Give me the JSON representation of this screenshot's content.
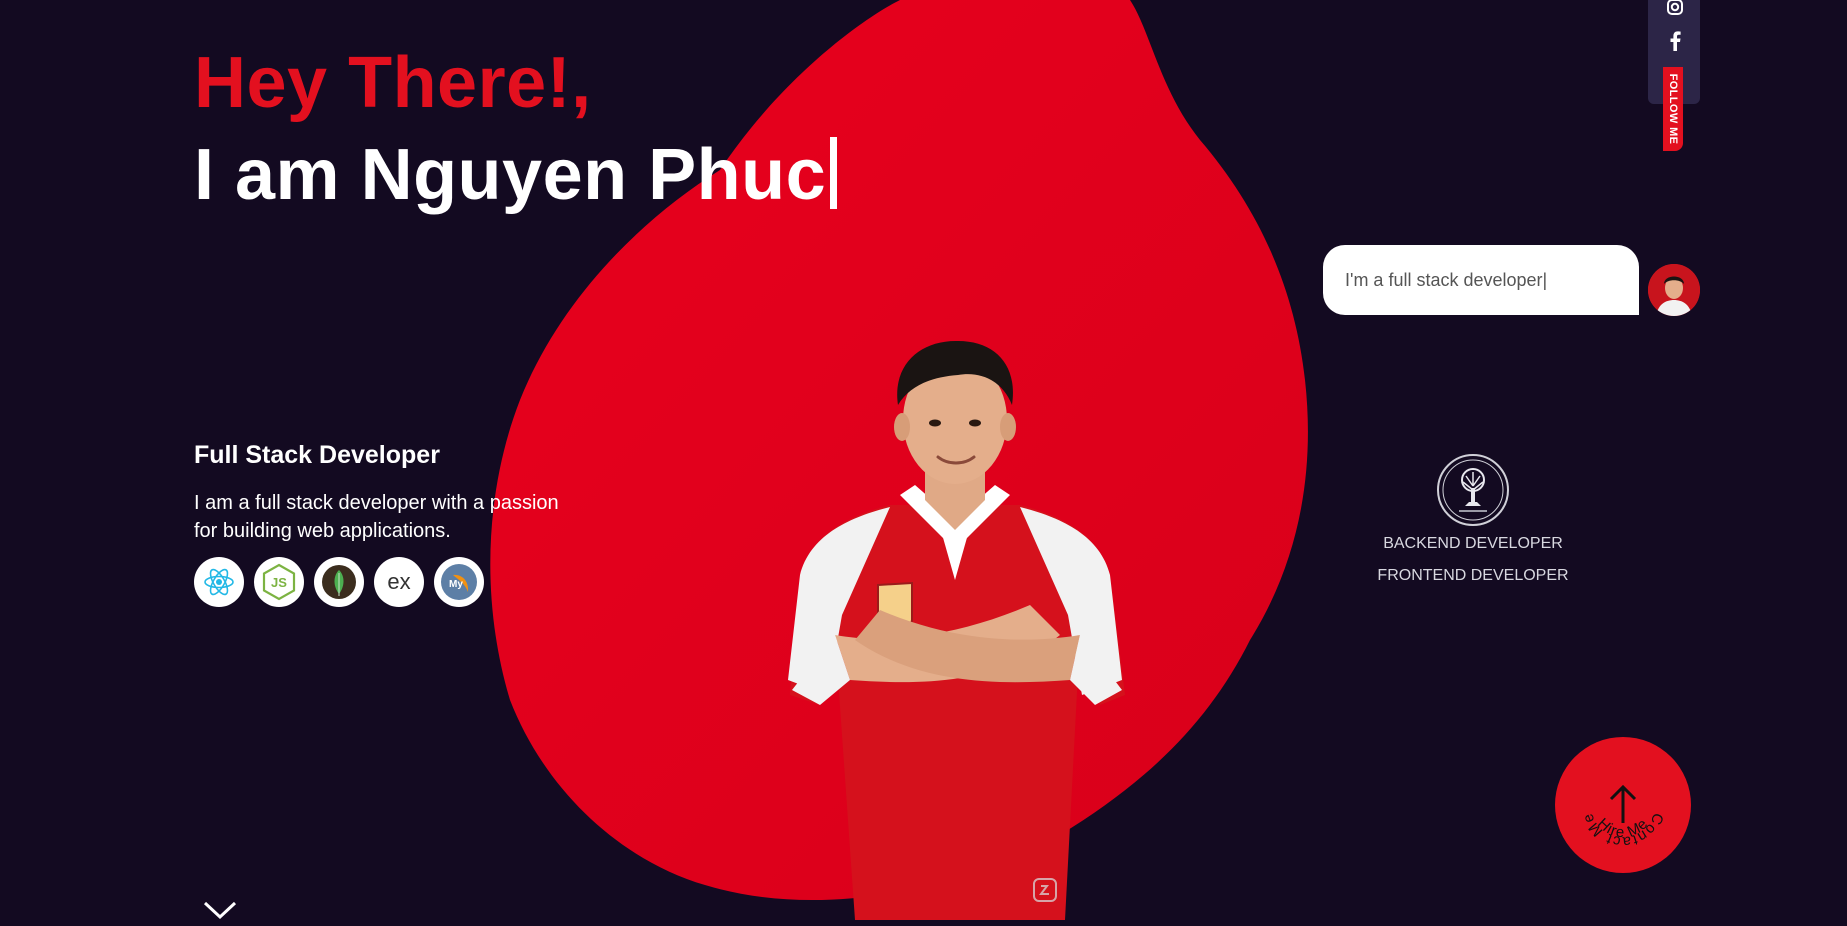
{
  "hero": {
    "greeting": "Hey There!,",
    "name": "I am Nguyen Phuc"
  },
  "intro": {
    "title": "Full Stack Developer",
    "description": "I am a full stack developer with a passion for building web applications."
  },
  "tech_stack": [
    {
      "icon": "react-icon"
    },
    {
      "icon": "javascript-icon",
      "label": "JS"
    },
    {
      "icon": "mongodb-icon"
    },
    {
      "icon": "express-icon",
      "label": "ex"
    },
    {
      "icon": "mysql-icon",
      "label": "My"
    }
  ],
  "social": {
    "follow_label": "FOLLOW ME",
    "icons": [
      "instagram-icon",
      "facebook-icon"
    ]
  },
  "chat": {
    "message": "I'm a full stack developer|"
  },
  "roles": {
    "backend": "BACKEND DEVELOPER",
    "frontend": "FRONTEND DEVELOPER"
  },
  "hire": {
    "top_text": "Contact Me",
    "bottom_text": "Hire Me"
  },
  "colors": {
    "background": "#130a21",
    "accent": "#e3101f",
    "social_bar": "#2c2547"
  }
}
